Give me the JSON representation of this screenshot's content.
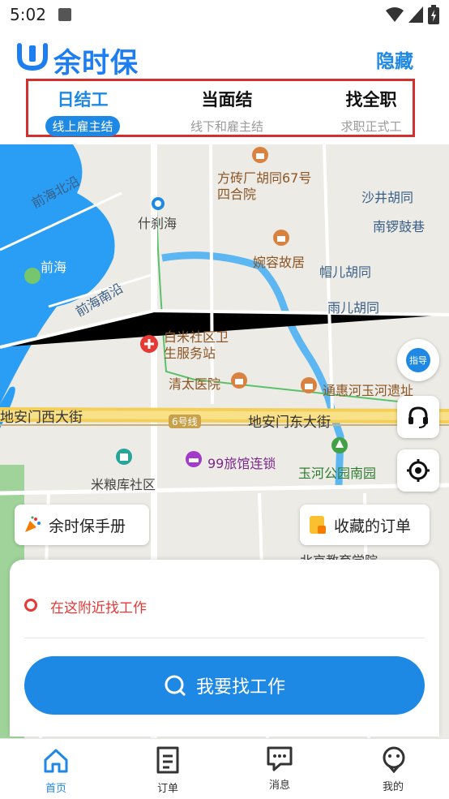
{
  "status_bar": {
    "time": "5:02"
  },
  "header": {
    "logo_text": "余时保",
    "hide_button": "隐藏",
    "tabs": [
      {
        "title": "日结工",
        "subtitle": "线上雇主结"
      },
      {
        "title": "当面结",
        "subtitle": "线下和雇主结"
      },
      {
        "title": "找全职",
        "subtitle": "求职正式工"
      }
    ]
  },
  "map": {
    "labels": [
      "前海北沿",
      "前海",
      "前海南沿",
      "什刹海",
      "方砖厂胡同67号四合院",
      "沙井胡同",
      "南锣鼓巷",
      "婉容故居",
      "帽儿胡同",
      "雨儿胡同",
      "白米社区卫生服务站",
      "清太医院",
      "通惠河玉河遗址",
      "地安门西大街",
      "6号线",
      "地安门东大街",
      "99旅馆连锁",
      "玉河公园南园",
      "米粮库社区",
      "北京教育学院"
    ],
    "guide_label": "指导"
  },
  "chips": {
    "handbook": "余时保手册",
    "favorites": "收藏的订单"
  },
  "card": {
    "nearby": "在这附近找工作",
    "find_job": "我要找工作"
  },
  "nav": [
    {
      "label": "首页",
      "icon": "home-icon"
    },
    {
      "label": "订单",
      "icon": "order-icon"
    },
    {
      "label": "消息",
      "icon": "message-icon"
    },
    {
      "label": "我的",
      "icon": "profile-icon"
    }
  ],
  "colors": {
    "brand": "#1e88e5",
    "alert": "#e53935"
  }
}
